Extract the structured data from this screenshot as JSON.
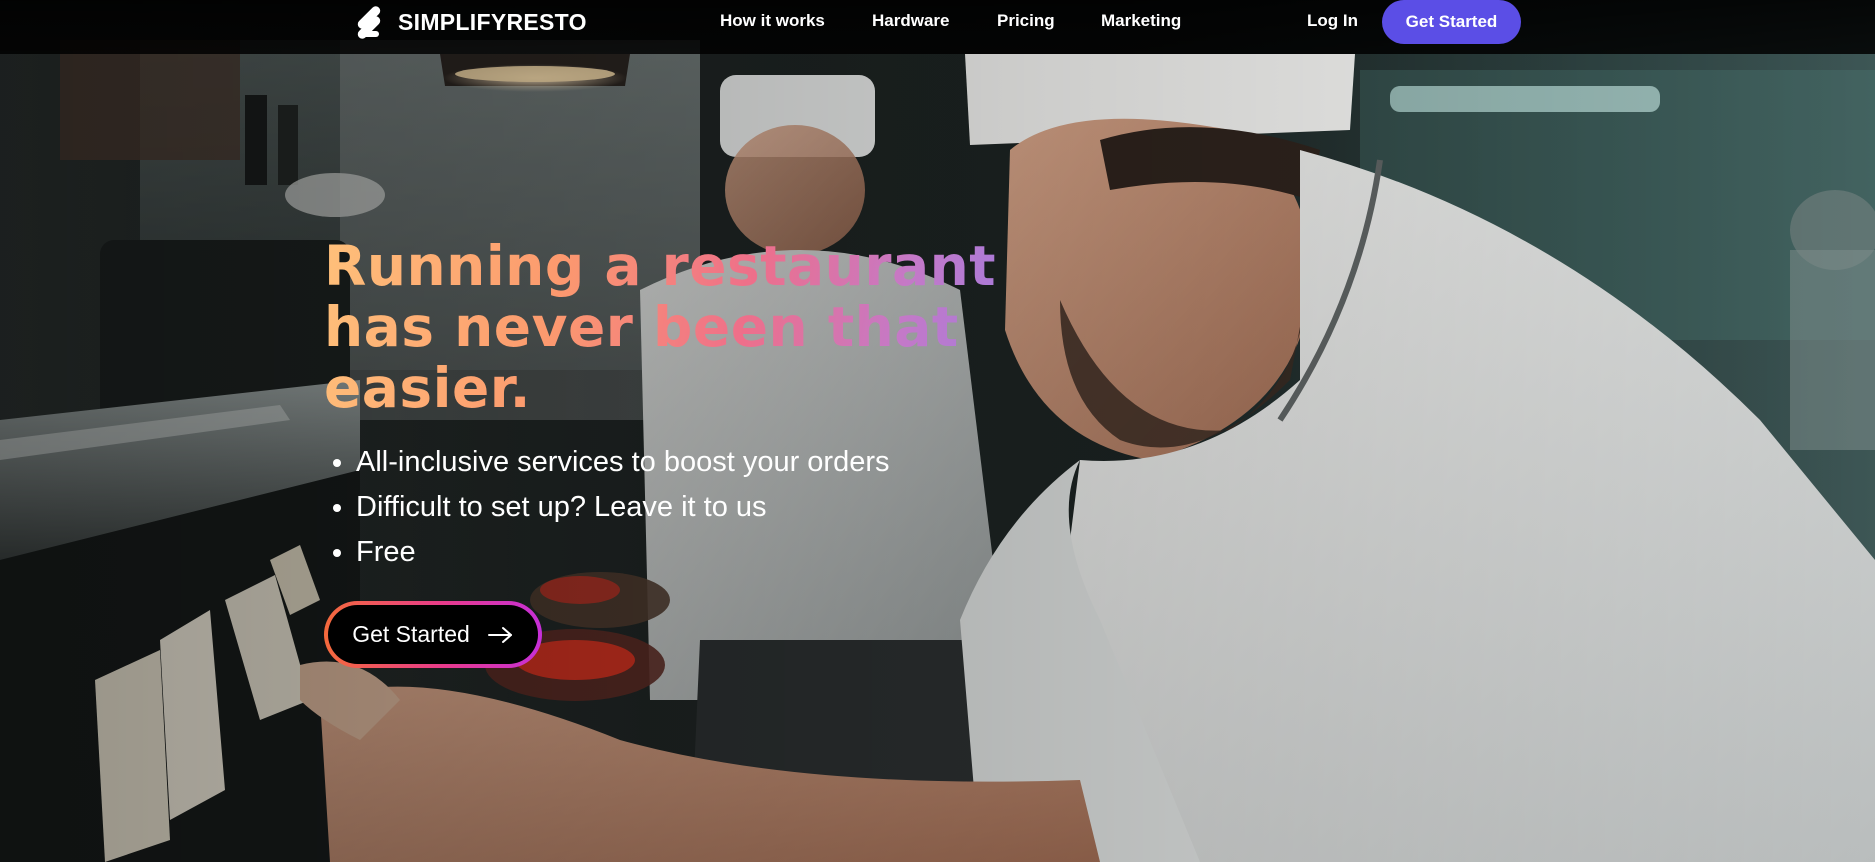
{
  "brand": {
    "name": "SIMPLIFYRESTO",
    "accent": "#5b4ee6"
  },
  "nav": {
    "links": [
      "How it works",
      "Hardware",
      "Pricing",
      "Marketing"
    ],
    "login": "Log In",
    "cta": "Get Started"
  },
  "hero": {
    "title_lines": [
      "Running a restaurant",
      "has never been that",
      "easier."
    ],
    "bullets": [
      "All-inclusive services to boost your orders",
      "Difficult to set up? Leave it to us",
      "Free"
    ],
    "cta": "Get Started",
    "cta_icon": "arrow-right-icon",
    "gradient": [
      "#ffc07a",
      "#ee6f8a",
      "#8d7bea"
    ]
  },
  "background_image": "restaurant-kitchen-chefs-photo"
}
